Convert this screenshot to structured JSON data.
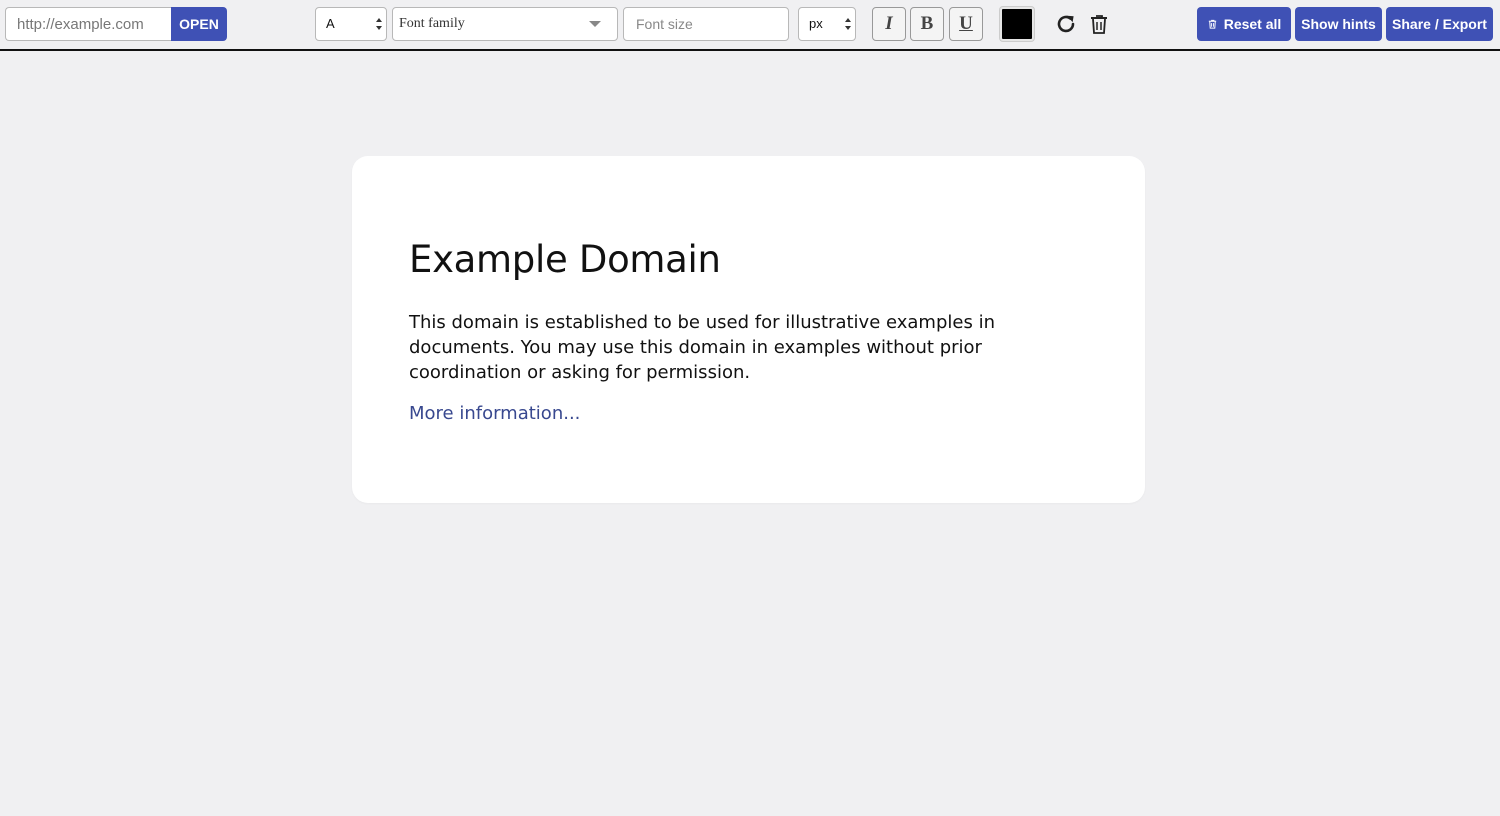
{
  "toolbar": {
    "url_placeholder": "http://example.com",
    "open_label": "OPEN",
    "element_select": "A",
    "font_family": "Font family",
    "font_size_placeholder": "Font size",
    "unit_select": "px",
    "italic_label": "I",
    "bold_label": "B",
    "underline_label": "U",
    "text_color": "#000000",
    "undo_icon": "undo-icon",
    "delete_icon": "trash-icon",
    "reset_label": "Reset all",
    "hints_label": "Show hints",
    "share_label": "Share / Export",
    "accent_color": "#3f51b5"
  },
  "page": {
    "heading": "Example Domain",
    "body": "This domain is established to be used for illustrative examples in documents. You may use this domain in examples without prior coordination or asking for permission.",
    "link": "More information..."
  }
}
